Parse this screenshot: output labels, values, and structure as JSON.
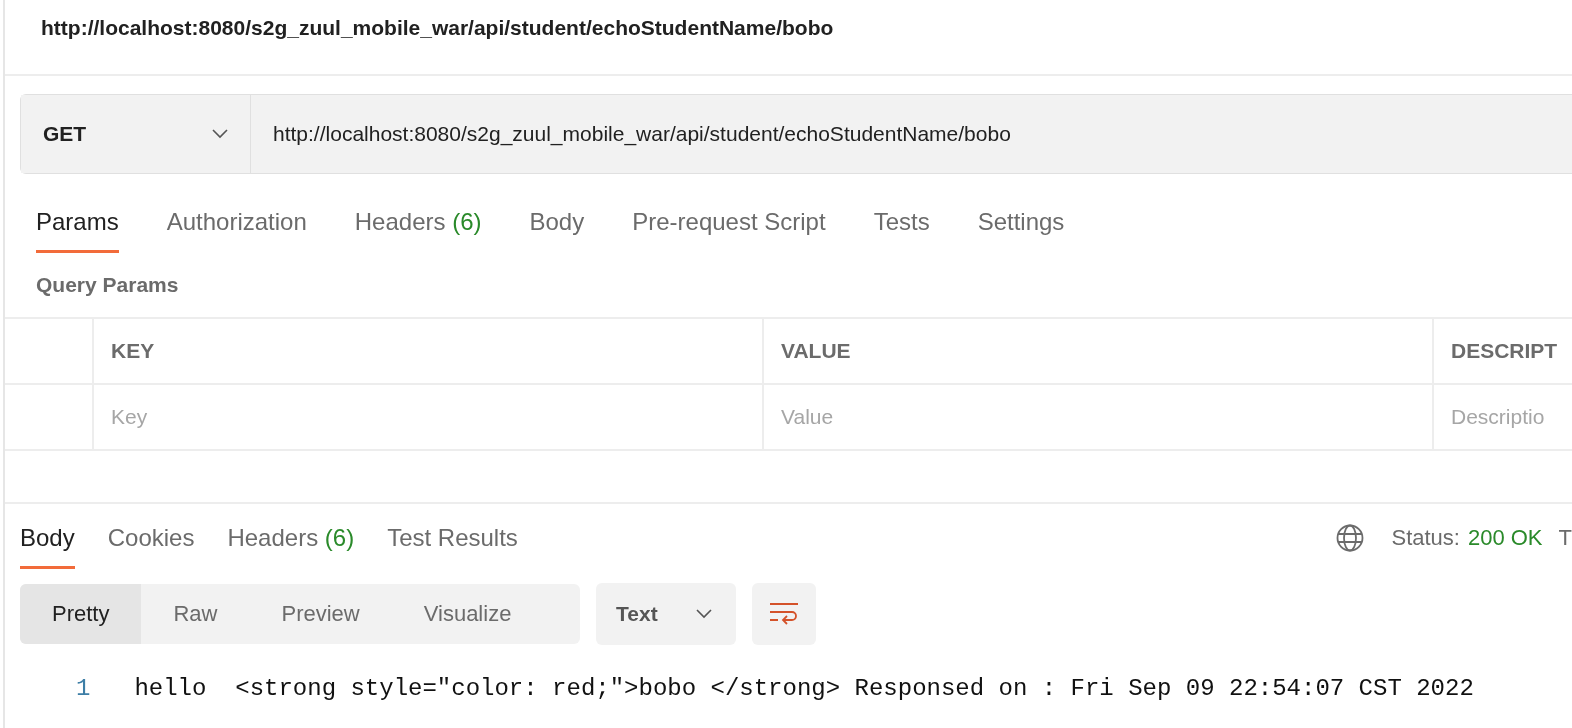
{
  "request_title": "http://localhost:8080/s2g_zuul_mobile_war/api/student/echoStudentName/bobo",
  "request": {
    "method": "GET",
    "url": "http://localhost:8080/s2g_zuul_mobile_war/api/student/echoStudentName/bobo"
  },
  "request_tabs": [
    {
      "label": "Params",
      "selected": true
    },
    {
      "label": "Authorization",
      "selected": false
    },
    {
      "label": "Headers",
      "count": "(6)",
      "selected": false
    },
    {
      "label": "Body",
      "selected": false
    },
    {
      "label": "Pre-request Script",
      "selected": false
    },
    {
      "label": "Tests",
      "selected": false
    },
    {
      "label": "Settings",
      "selected": false
    }
  ],
  "query_params": {
    "title": "Query Params",
    "columns": [
      "KEY",
      "VALUE",
      "DESCRIPT"
    ],
    "placeholders": [
      "Key",
      "Value",
      "Descriptio"
    ]
  },
  "response_tabs": [
    {
      "label": "Body",
      "selected": true
    },
    {
      "label": "Cookies",
      "selected": false
    },
    {
      "label": "Headers",
      "count": "(6)",
      "selected": false
    },
    {
      "label": "Test Results",
      "selected": false
    }
  ],
  "status": {
    "label": "Status:",
    "value": "200 OK",
    "column_3": "T"
  },
  "view_modes": [
    {
      "label": "Pretty",
      "selected": true
    },
    {
      "label": "Raw",
      "selected": false
    },
    {
      "label": "Preview",
      "selected": false
    },
    {
      "label": "Visualize",
      "selected": false
    }
  ],
  "format": "Text",
  "code_lines": [
    {
      "number": "1",
      "text": "hello  <strong style=\"color: red;\">bobo </strong> Responsed on : Fri Sep 09 22:54:07 CST 2022"
    }
  ]
}
